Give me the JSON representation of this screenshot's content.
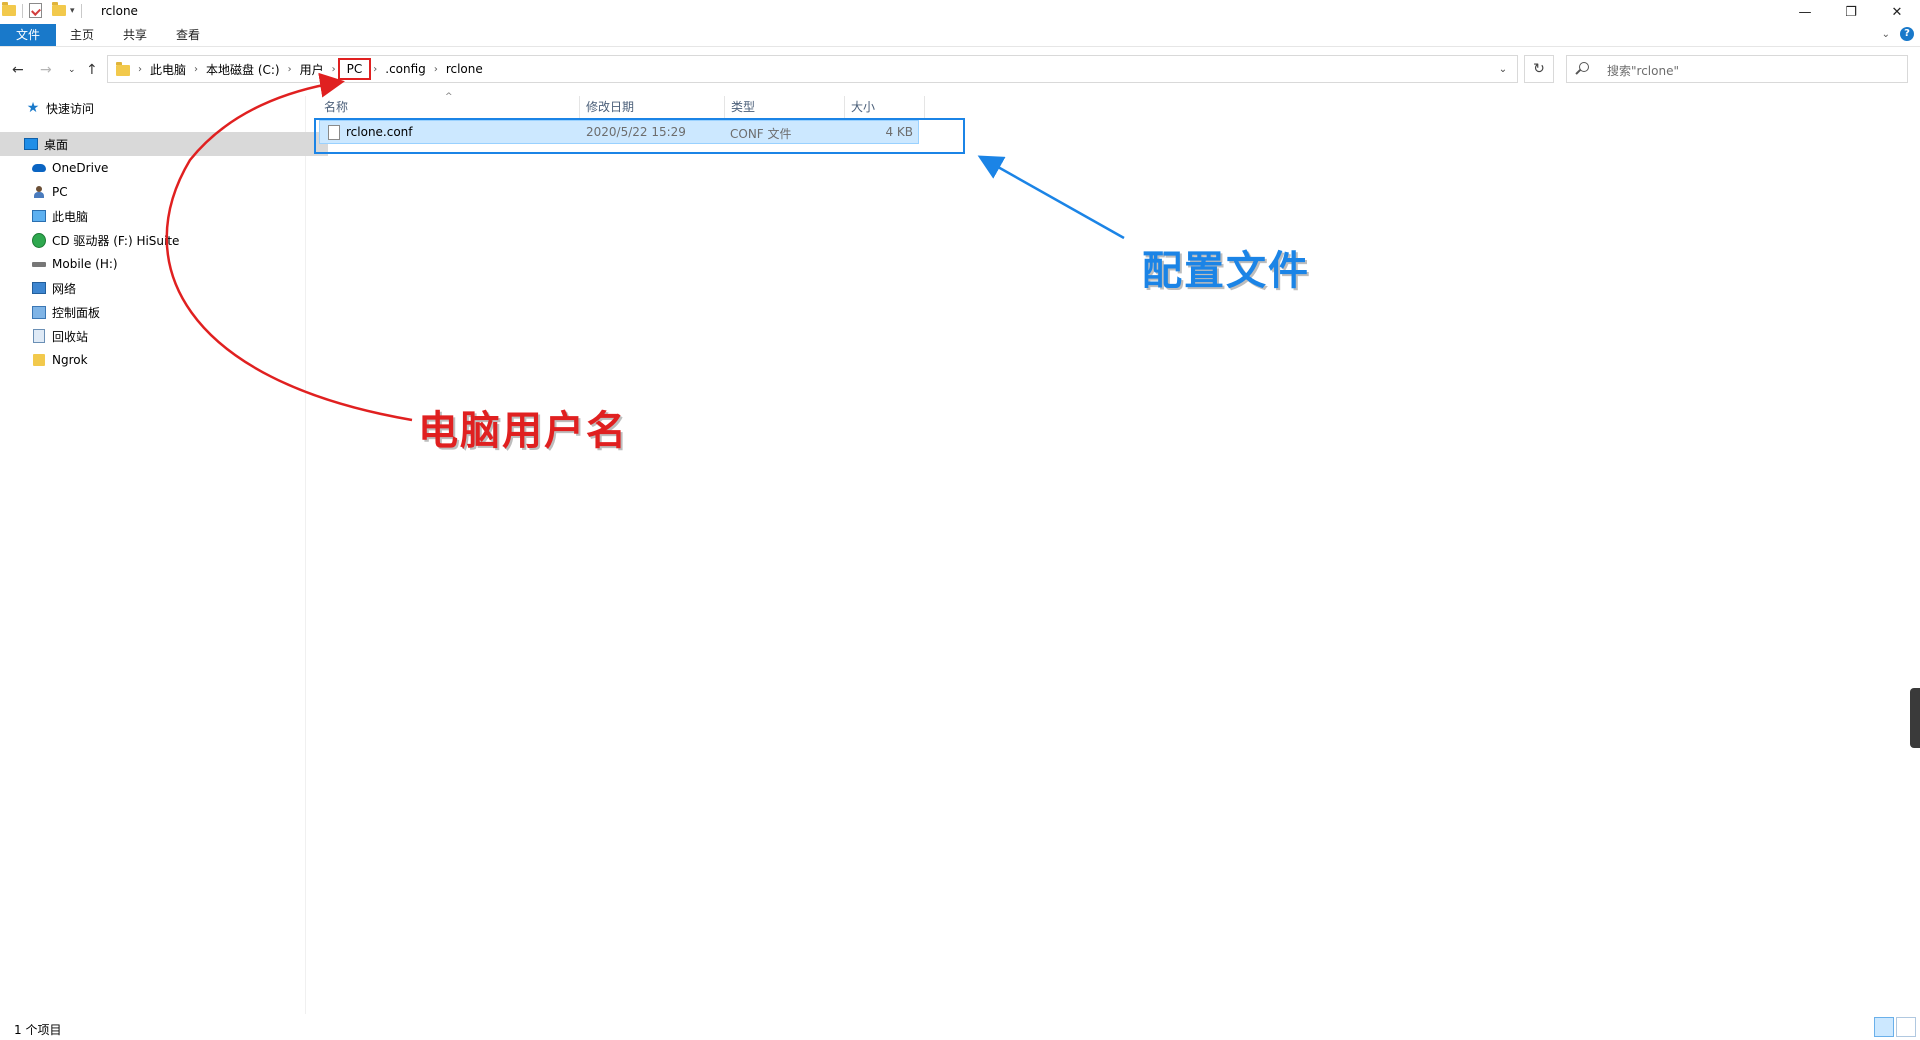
{
  "window": {
    "title": "rclone",
    "minimize": "—",
    "restore": "❐",
    "close": "✕"
  },
  "ribbon": {
    "tabs": [
      "文件",
      "主页",
      "共享",
      "查看"
    ]
  },
  "address": {
    "crumbs": [
      "此电脑",
      "本地磁盘 (C:)",
      "用户",
      "PC",
      ".config",
      "rclone"
    ]
  },
  "search": {
    "placeholder": "搜索\"rclone\""
  },
  "sidebar": {
    "items": [
      {
        "label": "快速访问",
        "icon": "star-icon"
      },
      {
        "label": "桌面",
        "icon": "desktop-icon"
      },
      {
        "label": "OneDrive",
        "icon": "onedrive-icon"
      },
      {
        "label": "PC",
        "icon": "user-icon"
      },
      {
        "label": "此电脑",
        "icon": "computer-icon"
      },
      {
        "label": "CD 驱动器 (F:) HiSuite",
        "icon": "cd-drive-icon"
      },
      {
        "label": "Mobile (H:)",
        "icon": "drive-icon"
      },
      {
        "label": "网络",
        "icon": "network-icon"
      },
      {
        "label": "控制面板",
        "icon": "control-panel-icon"
      },
      {
        "label": "回收站",
        "icon": "recycle-bin-icon"
      },
      {
        "label": "Ngrok",
        "icon": "folder-icon"
      }
    ]
  },
  "columns": [
    "名称",
    "修改日期",
    "类型",
    "大小"
  ],
  "files": [
    {
      "name": "rclone.conf",
      "modified": "2020/5/22 15:29",
      "type": "CONF 文件",
      "size": "4 KB"
    }
  ],
  "status": {
    "count": "1 个项目"
  },
  "annotations": {
    "username": "电脑用户名",
    "config_file": "配置文件"
  },
  "colors": {
    "accent": "#1979ca",
    "selection": "#cce8ff",
    "annotation_red": "#e02020",
    "annotation_blue": "#1b84e6"
  }
}
